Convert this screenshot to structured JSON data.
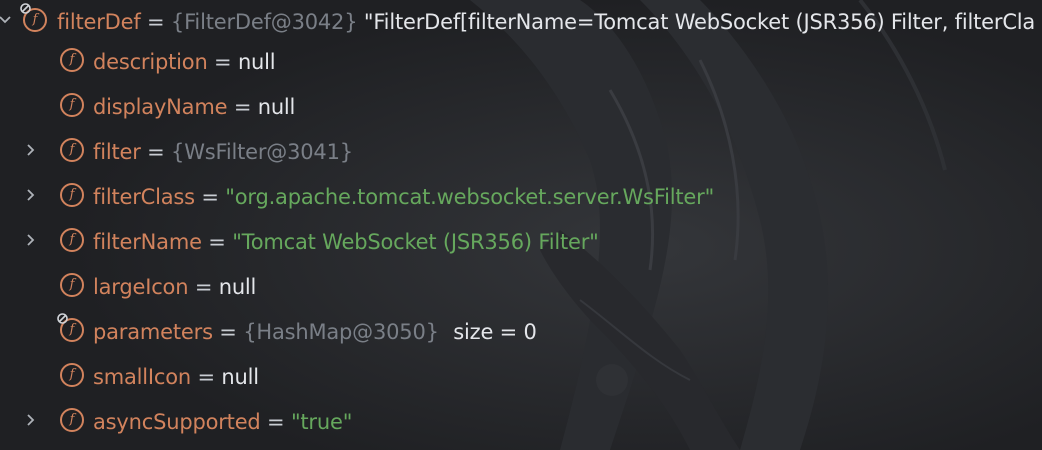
{
  "variables_tree": {
    "root": {
      "name": "filterDef",
      "equals": "=",
      "ref": "{FilterDef@3042}",
      "summary": "\"FilterDef[filterName=Tomcat WebSocket (JSR356) Filter, filterCla"
    },
    "fields": [
      {
        "name": "description",
        "equals": "=",
        "value": "null",
        "value_kind": "null",
        "expandable": false,
        "has_lock": false
      },
      {
        "name": "displayName",
        "equals": "=",
        "value": "null",
        "value_kind": "null",
        "expandable": false,
        "has_lock": false
      },
      {
        "name": "filter",
        "equals": "=",
        "value": "{WsFilter@3041}",
        "value_kind": "ref",
        "expandable": true,
        "has_lock": false
      },
      {
        "name": "filterClass",
        "equals": "=",
        "value": "\"org.apache.tomcat.websocket.server.WsFilter\"",
        "value_kind": "string",
        "expandable": true,
        "has_lock": false
      },
      {
        "name": "filterName",
        "equals": "=",
        "value": "\"Tomcat WebSocket (JSR356) Filter\"",
        "value_kind": "string",
        "expandable": true,
        "has_lock": false
      },
      {
        "name": "largeIcon",
        "equals": "=",
        "value": "null",
        "value_kind": "null",
        "expandable": false,
        "has_lock": false
      },
      {
        "name": "parameters",
        "equals": "=",
        "value": "{HashMap@3050}",
        "value_kind": "ref",
        "extra": "size = 0",
        "expandable": false,
        "has_lock": true
      },
      {
        "name": "smallIcon",
        "equals": "=",
        "value": "null",
        "value_kind": "null",
        "expandable": false,
        "has_lock": false
      },
      {
        "name": "asyncSupported",
        "equals": "=",
        "value": "\"true\"",
        "value_kind": "string",
        "expandable": true,
        "has_lock": false
      }
    ],
    "icons": {
      "field": "field-icon",
      "expand": "chevron-right-icon",
      "collapse": "chevron-down-icon",
      "lock": "lock-icon"
    },
    "colors": {
      "background": "#1f2023",
      "field_name": "#d2835d",
      "string_value": "#66a85d",
      "ref_value": "#7a7f87",
      "plain_value": "#e4e6ea"
    }
  }
}
